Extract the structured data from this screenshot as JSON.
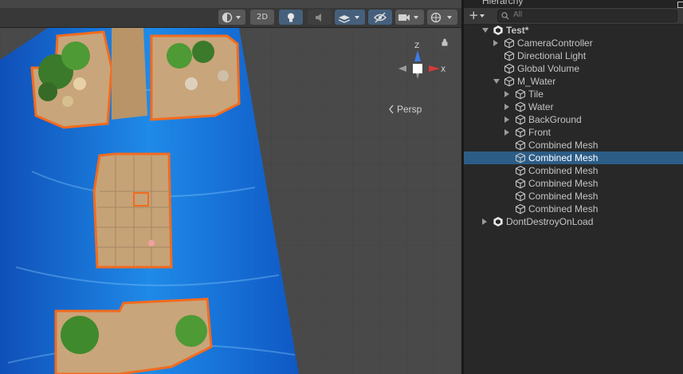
{
  "scene": {
    "toolbar": {
      "mode_2d_label": "2D"
    },
    "gizmo": {
      "axis_z": "Z",
      "axis_x": "X",
      "persp_label": "Persp"
    }
  },
  "hierarchy": {
    "title": "Hierarchy",
    "add_label": "+",
    "search_placeholder": "All",
    "items": [
      {
        "label": "Test*",
        "depth": 0,
        "icon": "unity-scene-icon",
        "expanded": true,
        "bold": true
      },
      {
        "label": "CameraController",
        "depth": 1,
        "icon": "cube-icon",
        "foldout": "collapsed"
      },
      {
        "label": "Directional Light",
        "depth": 1,
        "icon": "cube-icon"
      },
      {
        "label": "Global Volume",
        "depth": 1,
        "icon": "cube-icon"
      },
      {
        "label": "M_Water",
        "depth": 1,
        "icon": "cube-icon",
        "foldout": "expanded"
      },
      {
        "label": "Tile",
        "depth": 2,
        "icon": "cube-icon",
        "foldout": "collapsed"
      },
      {
        "label": "Water",
        "depth": 2,
        "icon": "cube-icon",
        "foldout": "collapsed"
      },
      {
        "label": "BackGround",
        "depth": 2,
        "icon": "cube-icon",
        "foldout": "collapsed"
      },
      {
        "label": "Front",
        "depth": 2,
        "icon": "cube-icon",
        "foldout": "collapsed"
      },
      {
        "label": "Combined Mesh",
        "depth": 2,
        "icon": "cube-icon"
      },
      {
        "label": "Combined Mesh",
        "depth": 2,
        "icon": "cube-icon",
        "selected": true
      },
      {
        "label": "Combined Mesh",
        "depth": 2,
        "icon": "cube-icon"
      },
      {
        "label": "Combined Mesh",
        "depth": 2,
        "icon": "cube-icon"
      },
      {
        "label": "Combined Mesh",
        "depth": 2,
        "icon": "cube-icon"
      },
      {
        "label": "Combined Mesh",
        "depth": 2,
        "icon": "cube-icon"
      },
      {
        "label": "DontDestroyOnLoad",
        "depth": 0,
        "icon": "unity-scene-icon",
        "foldout": "collapsed"
      }
    ]
  },
  "colors": {
    "selection": "#2c5d87",
    "water": "#1a6fd6",
    "outline": "#f36b1e",
    "sand": "#c9a57b"
  }
}
